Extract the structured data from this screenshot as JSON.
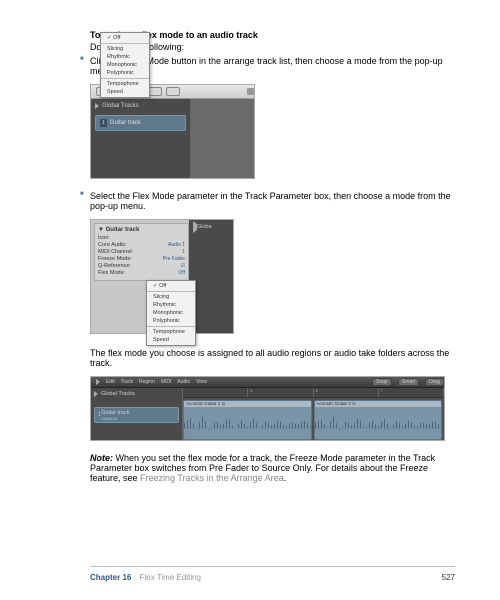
{
  "heading": "To assign a flex mode to an audio track",
  "intro": "Do one of the following:",
  "bullet1": "Click the Flex Mode button in the arrange track list, then choose a mode from the pop-up menu.",
  "bullet2": "Select the Flex Mode parameter in the Track Parameter box, then choose a mode from the pop-up menu.",
  "after_fig2": "The flex mode you choose is assigned to all audio regions or audio take folders across the track.",
  "note_label": "Note:",
  "note_text": " When you set the flex mode for a track, the Freeze Mode parameter in the Track Parameter box switches from Pre Fader to Source Only. For details about the Freeze feature, see ",
  "note_link": "Freezing Tracks in the Arrange Area",
  "note_end": ".",
  "footer": {
    "chapter": "Chapter 16",
    "title": "Flex Time Editing",
    "page": "527"
  },
  "fig1": {
    "global_tracks": "Global Tracks",
    "track_num": "1",
    "track_name": "Guitar track",
    "menu": [
      "Off",
      "Slicing",
      "Rhythmic",
      "Monophonic",
      "Polyphonic",
      "Tempophone",
      "Speed"
    ]
  },
  "fig2": {
    "box_title": "Guitar track",
    "params": [
      {
        "label": "Icon:",
        "val": ""
      },
      {
        "label": "Core Audio:",
        "val": "Audio 1"
      },
      {
        "label": "MIDI Channel:",
        "val": "1"
      },
      {
        "label": "Freeze Mode:",
        "val": "Pre Fader"
      },
      {
        "label": "Q-Reference:",
        "val": "☑"
      },
      {
        "label": "Flex Mode:",
        "val": "Off"
      }
    ],
    "right_label": "Globa",
    "menu": [
      "Off",
      "Slicing",
      "Rhythmic",
      "Monophonic",
      "Polyphonic",
      "Tempophone",
      "Speed"
    ]
  },
  "fig3": {
    "tabs": [
      "Edit",
      "Track",
      "Region",
      "MIDI",
      "Audio",
      "View"
    ],
    "right_tabs": [
      "Snap",
      "Smart",
      "Drag"
    ],
    "global_tracks": "Global Tracks",
    "track_num": "1",
    "track_name": "Guitar track",
    "track_sub": "Rhythmic",
    "ruler": [
      "",
      "3",
      "5",
      "7"
    ],
    "regions": [
      "Acoustic Guitar 1 ⊙",
      "Acoustic Guitar 2 ⊙"
    ]
  }
}
